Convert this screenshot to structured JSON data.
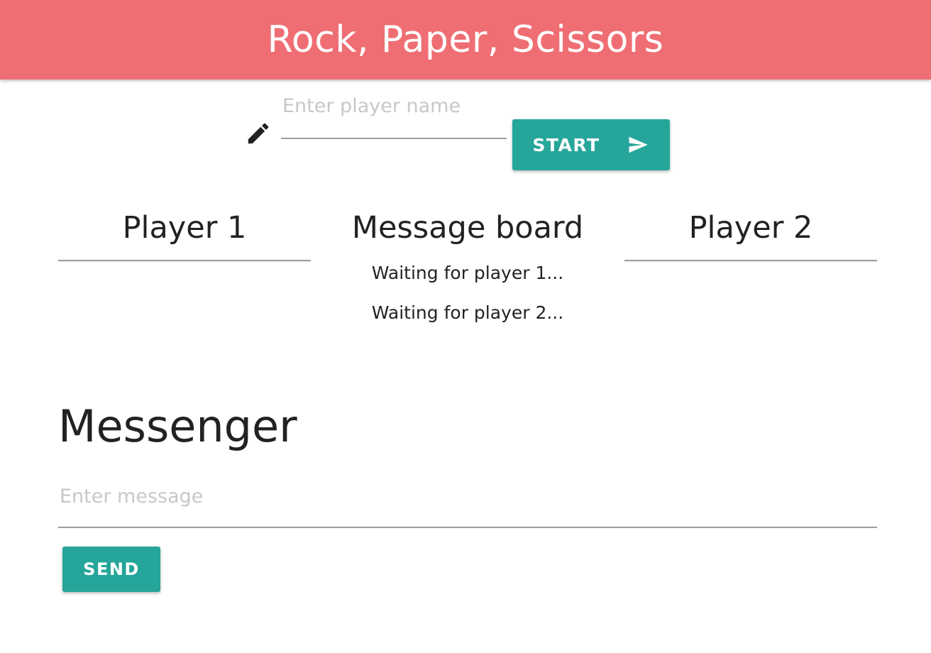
{
  "header": {
    "title": "Rock, Paper, Scissors",
    "color": "#ef6e73"
  },
  "player_form": {
    "icon": "pencil-icon",
    "name_placeholder": "Enter player name",
    "name_value": "",
    "start_label": "START",
    "start_icon": "send-icon",
    "button_color": "#26a69a"
  },
  "columns": {
    "player1": {
      "title": "Player 1"
    },
    "message_board": {
      "title": "Message board",
      "messages": [
        "Waiting for player 1...",
        "Waiting for player 2..."
      ]
    },
    "player2": {
      "title": "Player 2"
    }
  },
  "messenger": {
    "title": "Messenger",
    "message_placeholder": "Enter message",
    "message_value": "",
    "send_label": "SEND"
  }
}
